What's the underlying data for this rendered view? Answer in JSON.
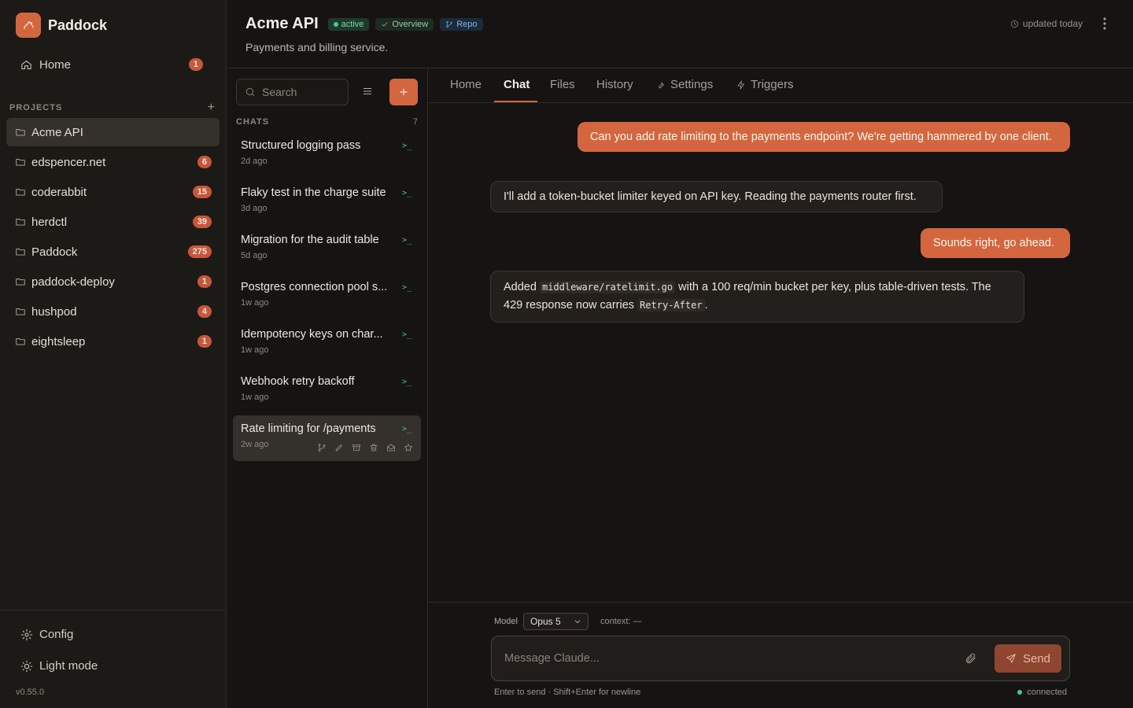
{
  "brand": {
    "name": "Paddock"
  },
  "sidebar": {
    "home_label": "Home",
    "home_badge": "1",
    "projects_header": "PROJECTS",
    "projects_add": "+",
    "projects": [
      {
        "name": "Acme API",
        "badge": ""
      },
      {
        "name": "edspencer.net",
        "badge": "6"
      },
      {
        "name": "coderabbit",
        "badge": "15"
      },
      {
        "name": "herdctl",
        "badge": "39"
      },
      {
        "name": "Paddock",
        "badge": "275"
      },
      {
        "name": "paddock-deploy",
        "badge": "1"
      },
      {
        "name": "hushpod",
        "badge": "4"
      },
      {
        "name": "eightsleep",
        "badge": "1"
      }
    ],
    "config_label": "Config",
    "lightmode_label": "Light mode",
    "version": "v0.55.0"
  },
  "header": {
    "title": "Acme API",
    "status_pill": "active",
    "overview_pill": "Overview",
    "repo_pill": "Repo",
    "subtitle": "Payments and billing service.",
    "updated": "updated today"
  },
  "chatlist": {
    "search_placeholder": "Search",
    "header": "CHATS",
    "count": "7",
    "terminal_glyph": ">_",
    "items": [
      {
        "name": "Structured logging pass",
        "ago": "2d ago"
      },
      {
        "name": "Flaky test in the charge suite",
        "ago": "3d ago"
      },
      {
        "name": "Migration for the audit table",
        "ago": "5d ago"
      },
      {
        "name": "Postgres connection pool s...",
        "ago": "1w ago"
      },
      {
        "name": "Idempotency keys on char...",
        "ago": "1w ago"
      },
      {
        "name": "Webhook retry backoff",
        "ago": "1w ago"
      },
      {
        "name": "Rate limiting for /payments",
        "ago": "2w ago"
      }
    ]
  },
  "tabs": {
    "home": "Home",
    "chat": "Chat",
    "files": "Files",
    "history": "History",
    "settings": "Settings",
    "triggers": "Triggers"
  },
  "messages": {
    "m1": "Can you add rate limiting to the payments endpoint? We're getting hammered by one client.",
    "m2": "I'll add a token-bucket limiter keyed on API key. Reading the payments router first.",
    "m3": "Sounds right, go ahead.",
    "m4_a": "Added ",
    "m4_code1": "middleware/ratelimit.go",
    "m4_b": " with a 100 req/min bucket per key, plus table-driven tests. The 429 response now carries ",
    "m4_code2": "Retry-After",
    "m4_c": "."
  },
  "composer": {
    "model_label": "Model",
    "model_value": "Opus 5",
    "context": "context: —",
    "placeholder": "Message Claude...",
    "send_label": "Send",
    "hint": "Enter to send · Shift+Enter for newline",
    "status": "connected"
  }
}
